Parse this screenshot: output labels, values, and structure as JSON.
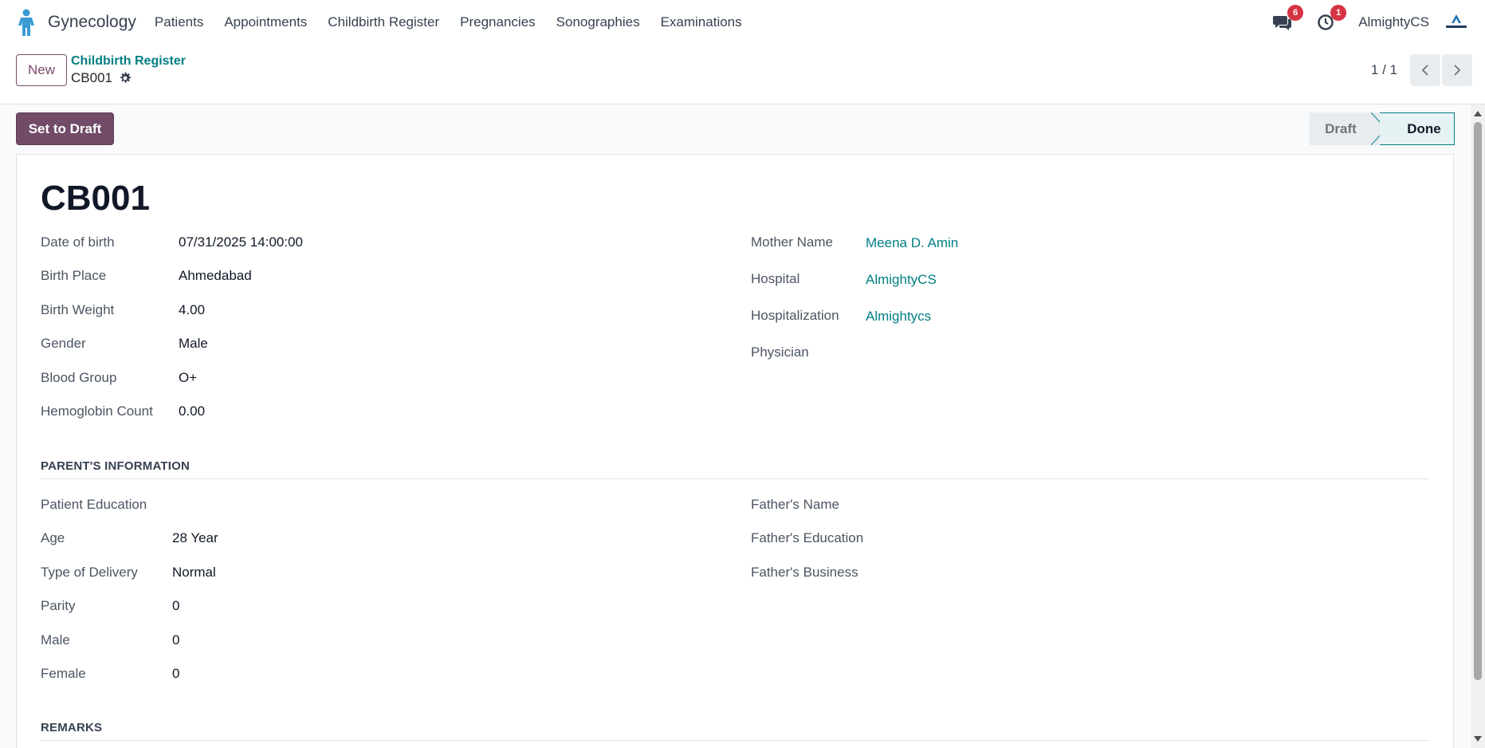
{
  "nav": {
    "app_name": "Gynecology",
    "menu": [
      "Patients",
      "Appointments",
      "Childbirth Register",
      "Pregnancies",
      "Sonographies",
      "Examinations"
    ],
    "messages_count": "6",
    "activities_count": "1",
    "company": "AlmightyCS"
  },
  "control": {
    "new_label": "New",
    "breadcrumb_parent": "Childbirth Register",
    "breadcrumb_current": "CB001",
    "pager": "1 / 1"
  },
  "actions": {
    "set_to_draft": "Set to Draft"
  },
  "status": {
    "stages": [
      "Draft",
      "Done"
    ],
    "current": "Done"
  },
  "record": {
    "title": "CB001",
    "left": [
      {
        "label": "Date of birth",
        "value": "07/31/2025 14:00:00"
      },
      {
        "label": "Birth Place",
        "value": "Ahmedabad"
      },
      {
        "label": "Birth Weight",
        "value": "4.00"
      },
      {
        "label": "Gender",
        "value": "Male"
      },
      {
        "label": "Blood Group",
        "value": "O+"
      },
      {
        "label": "Hemoglobin Count",
        "value": "0.00"
      }
    ],
    "right": [
      {
        "label": "Mother Name",
        "value": "Meena D. Amin"
      },
      {
        "label": "Hospital",
        "value": "AlmightyCS"
      },
      {
        "label": "Hospitalization",
        "value": "Almightycs"
      },
      {
        "label": "Physician",
        "value": ""
      }
    ]
  },
  "parents": {
    "title": "PARENT'S INFORMATION",
    "left": [
      {
        "label": "Patient Education",
        "value": ""
      },
      {
        "label": "Age",
        "value": "28 Year"
      },
      {
        "label": "Type of Delivery",
        "value": "Normal"
      },
      {
        "label": "Parity",
        "value": "0"
      },
      {
        "label": "Male",
        "value": "0"
      },
      {
        "label": "Female",
        "value": "0"
      }
    ],
    "right": [
      {
        "label": "Father's Name",
        "value": ""
      },
      {
        "label": "Father's Education",
        "value": ""
      },
      {
        "label": "Father's Business",
        "value": ""
      }
    ]
  },
  "remarks": {
    "title": "REMARKS"
  },
  "colors": {
    "primary": "#714b67",
    "link": "#017e84",
    "badge": "#d63443"
  }
}
